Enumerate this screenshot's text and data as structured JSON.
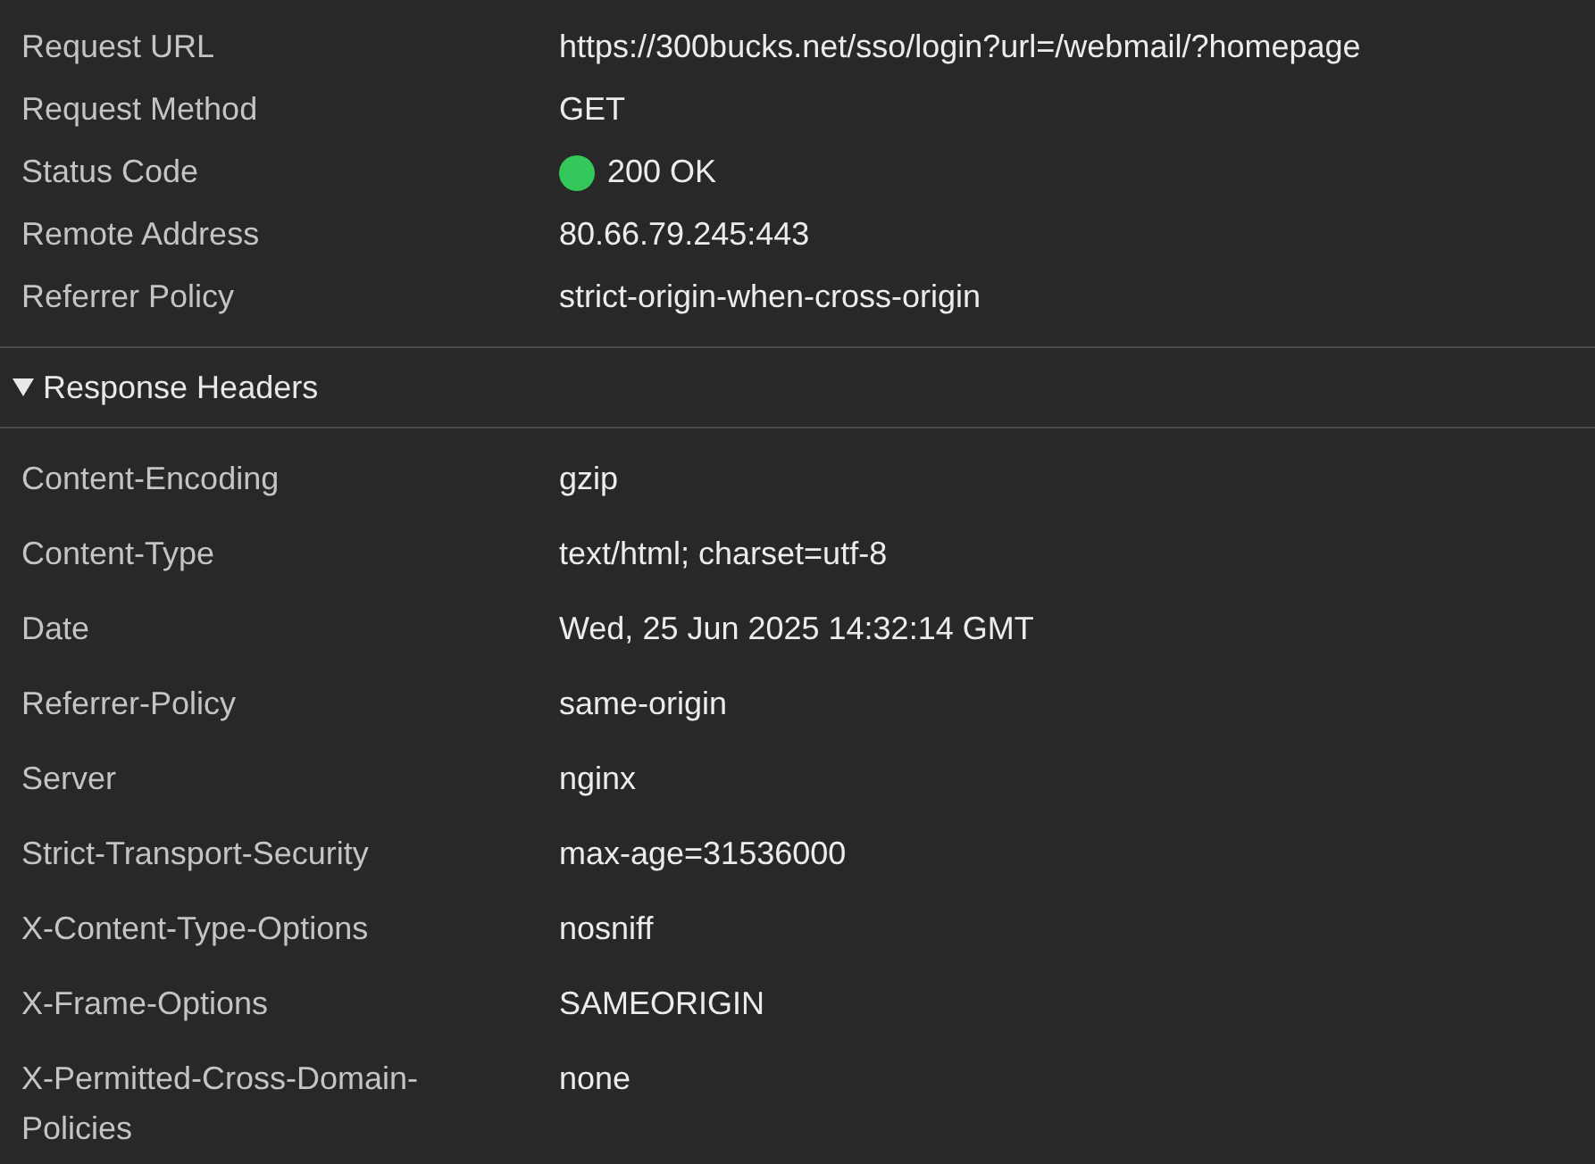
{
  "general": [
    {
      "name": "Request URL",
      "value": "https://300bucks.net/sso/login?url=/webmail/?homepage"
    },
    {
      "name": "Request Method",
      "value": "GET"
    },
    {
      "name": "Status Code",
      "value": "200 OK",
      "color": "#34c759"
    },
    {
      "name": "Remote Address",
      "value": "80.66.79.245:443"
    },
    {
      "name": "Referrer Policy",
      "value": "strict-origin-when-cross-origin"
    }
  ],
  "response_headers": {
    "title": "Response Headers",
    "expanded": true,
    "rows": [
      {
        "name": "Content-Encoding",
        "value": "gzip"
      },
      {
        "name": "Content-Type",
        "value": "text/html; charset=utf-8"
      },
      {
        "name": "Date",
        "value": "Wed, 25 Jun 2025 14:32:14 GMT"
      },
      {
        "name": "Referrer-Policy",
        "value": "same-origin"
      },
      {
        "name": "Server",
        "value": "nginx"
      },
      {
        "name": "Strict-Transport-Security",
        "value": "max-age=31536000"
      },
      {
        "name": "X-Content-Type-Options",
        "value": "nosniff"
      },
      {
        "name": "X-Frame-Options",
        "value": "SAMEORIGIN"
      },
      {
        "name": "X-Permitted-Cross-Domain-Policies",
        "value": "none"
      }
    ]
  }
}
